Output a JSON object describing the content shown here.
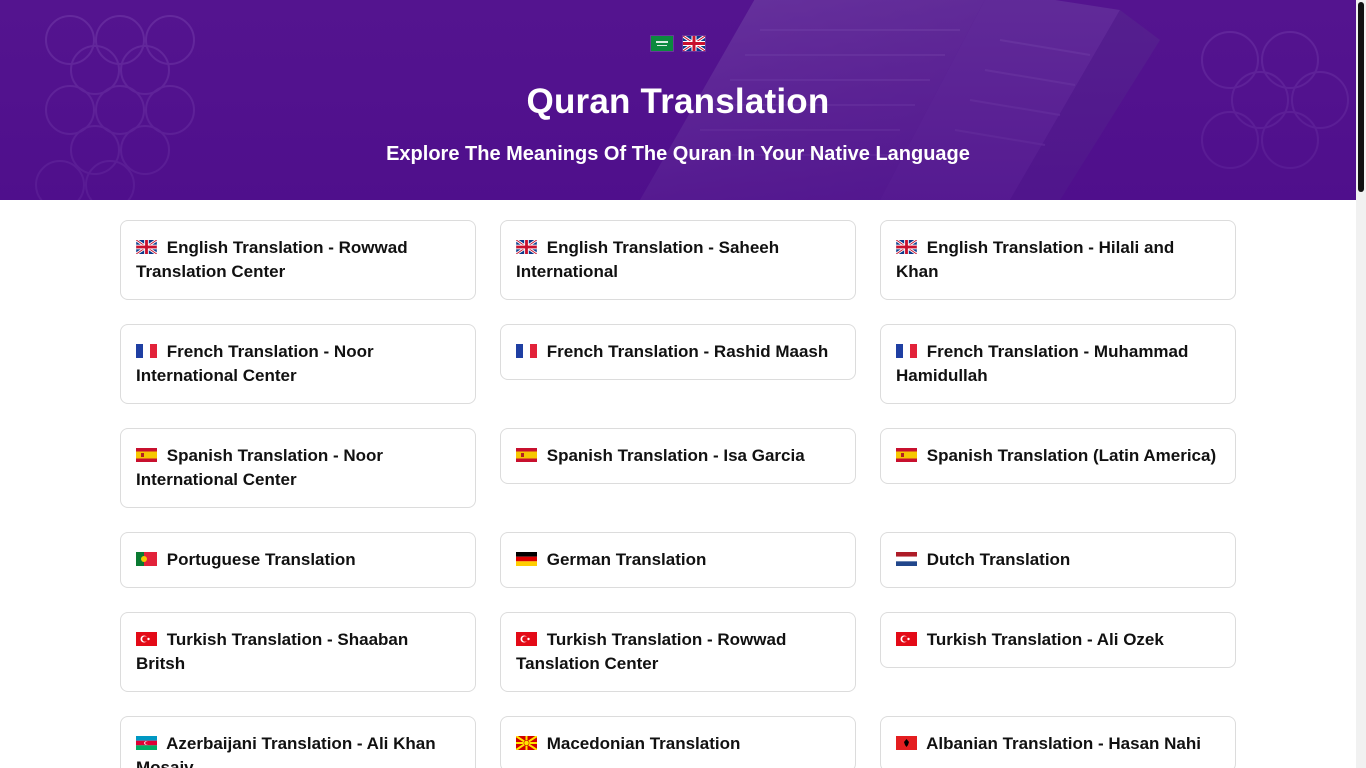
{
  "hero": {
    "title": "Quran Translation",
    "subtitle": "Explore The Meanings Of The Quran In Your Native Language",
    "languages": [
      {
        "flag": "sa-flag-icon"
      },
      {
        "flag": "uk-flag-icon"
      }
    ]
  },
  "translations": [
    {
      "label": "English Translation - Rowwad Translation Center",
      "flag": "uk"
    },
    {
      "label": "English Translation - Saheeh International",
      "flag": "uk"
    },
    {
      "label": "English Translation - Hilali and Khan",
      "flag": "uk"
    },
    {
      "label": "French Translation - Noor International Center",
      "flag": "fr"
    },
    {
      "label": "French Translation - Rashid Maash",
      "flag": "fr"
    },
    {
      "label": "French Translation - Muhammad Hamidullah",
      "flag": "fr"
    },
    {
      "label": "Spanish Translation - Noor International Center",
      "flag": "es"
    },
    {
      "label": "Spanish Translation - Isa Garcia",
      "flag": "es"
    },
    {
      "label": "Spanish Translation (Latin America)",
      "flag": "es"
    },
    {
      "label": "Portuguese Translation",
      "flag": "pt"
    },
    {
      "label": "German Translation",
      "flag": "de"
    },
    {
      "label": "Dutch Translation",
      "flag": "nl"
    },
    {
      "label": "Turkish Translation - Shaaban Britsh",
      "flag": "tr"
    },
    {
      "label": "Turkish Translation - Rowwad Tanslation Center",
      "flag": "tr"
    },
    {
      "label": "Turkish Translation - Ali Ozek",
      "flag": "tr"
    },
    {
      "label": "Azerbaijani Translation - Ali Khan Mosaiv",
      "flag": "az"
    },
    {
      "label": "Macedonian Translation",
      "flag": "mk"
    },
    {
      "label": "Albanian Translation - Hasan Nahi",
      "flag": "al"
    }
  ],
  "colors": {
    "hero_purple": "#4e1287",
    "card_border": "#dcdcdc",
    "text": "#111111"
  }
}
